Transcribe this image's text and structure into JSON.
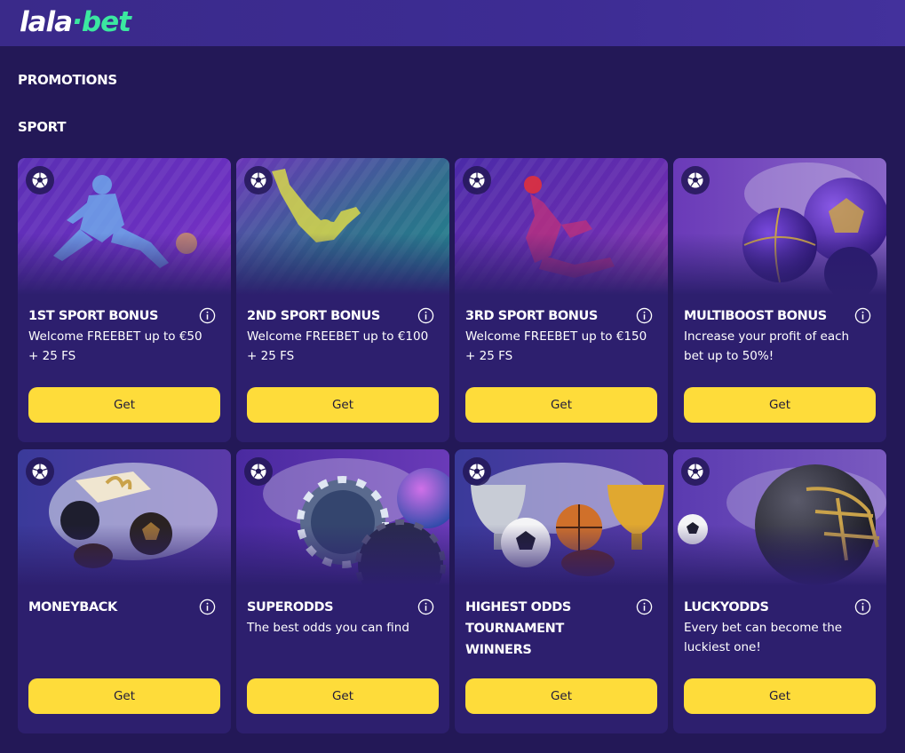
{
  "header": {
    "logo_part1": "lala",
    "logo_dot": "·",
    "logo_part2": "bet"
  },
  "page_title": "PROMOTIONS",
  "section_title": "SPORT",
  "colors": {
    "background": "#231857",
    "card": "#2d1f6e",
    "button": "#fedc3a",
    "brand_green": "#3be8a0"
  },
  "badge_icon": "soccer-ball-icon",
  "cards": [
    {
      "title": "1ST SPORT BONUS",
      "description": "Welcome FREEBET up to €50 + 25 FS",
      "button": "Get"
    },
    {
      "title": "2ND SPORT BONUS",
      "description": "Welcome FREEBET up to €100 + 25 FS",
      "button": "Get"
    },
    {
      "title": "3RD SPORT BONUS",
      "description": "Welcome FREEBET up to €150 + 25 FS",
      "button": "Get"
    },
    {
      "title": "MULTIBOOST BONUS",
      "description": "Increase your profit of each bet up to 50%!",
      "button": "Get"
    },
    {
      "title": "MONEYBACK",
      "description": "",
      "button": "Get"
    },
    {
      "title": "SUPERODDS",
      "description": "The best odds you can find",
      "button": "Get"
    },
    {
      "title": "HIGHEST ODDS TOURNAMENT WINNERS",
      "description": "",
      "button": "Get"
    },
    {
      "title": "LUCKYODDS",
      "description": "Every bet can become the luckiest one!",
      "button": "Get"
    }
  ]
}
